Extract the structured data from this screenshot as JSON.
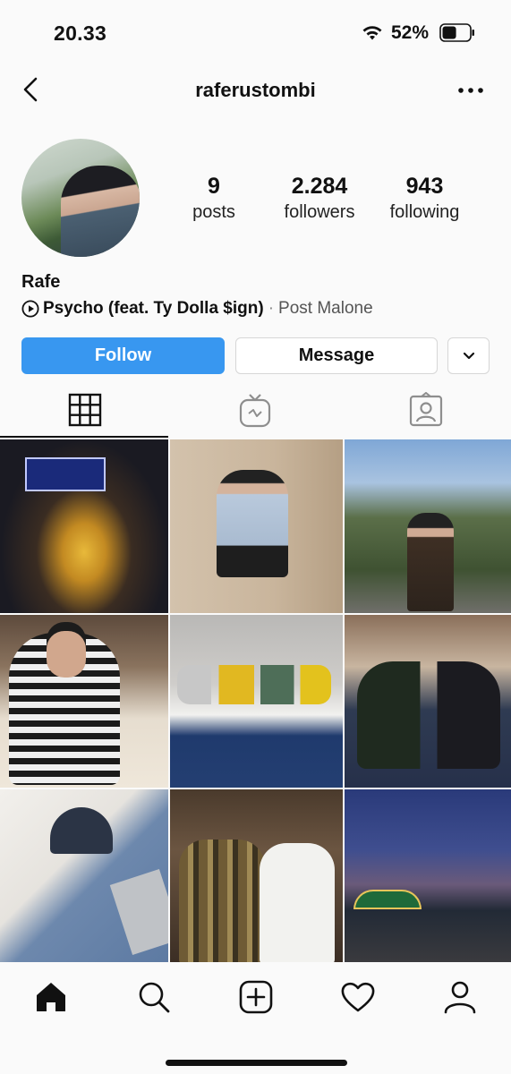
{
  "status_bar": {
    "time": "20.33",
    "battery_percent": "52%",
    "battery_level": 0.52
  },
  "header": {
    "username": "raferustombi"
  },
  "profile": {
    "display_name": "Rafe",
    "stats": [
      {
        "value": "9",
        "label": "posts"
      },
      {
        "value": "2.284",
        "label": "followers"
      },
      {
        "value": "943",
        "label": "following"
      }
    ],
    "music": {
      "song": "Psycho (feat. Ty Dolla $ign)",
      "separator": "·",
      "artist": "Post Malone"
    }
  },
  "actions": {
    "follow_label": "Follow",
    "message_label": "Message"
  },
  "colors": {
    "accent": "#3897f0",
    "background": "#fafafa",
    "text": "#111111"
  },
  "tabs": [
    {
      "icon": "grid-icon",
      "selected": true
    },
    {
      "icon": "igtv-icon",
      "selected": false
    },
    {
      "icon": "tagged-icon",
      "selected": false
    }
  ],
  "bottom_nav": [
    {
      "icon": "home-icon",
      "selected": true
    },
    {
      "icon": "search-icon",
      "selected": false
    },
    {
      "icon": "new-post-icon",
      "selected": false
    },
    {
      "icon": "activity-heart-icon",
      "selected": false
    },
    {
      "icon": "profile-icon",
      "selected": false
    }
  ]
}
